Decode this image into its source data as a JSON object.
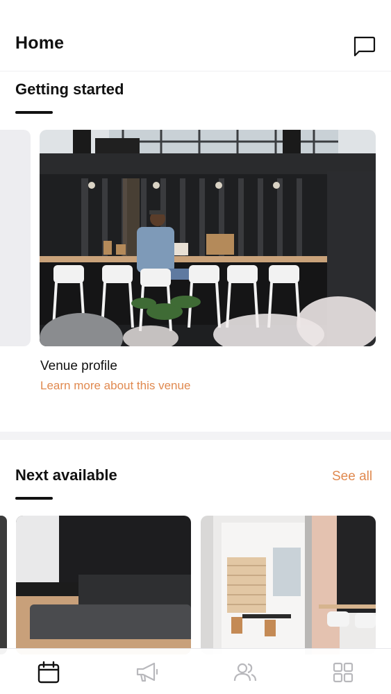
{
  "header": {
    "title": "Home",
    "chat_icon": "chat-bubble-icon"
  },
  "getting_started": {
    "title": "Getting started",
    "card": {
      "title": "Venue profile",
      "link": "Learn more about this venue"
    }
  },
  "next_available": {
    "title": "Next available",
    "see_all": "See all"
  },
  "tabbar": {
    "tabs": [
      {
        "icon": "calendar-icon",
        "active": true
      },
      {
        "icon": "megaphone-icon",
        "active": false
      },
      {
        "icon": "people-icon",
        "active": false
      },
      {
        "icon": "grid-icon",
        "active": false
      }
    ]
  },
  "colors": {
    "accent": "#e0894f",
    "text": "#111111",
    "inactive_icon": "#b8b8bc"
  }
}
